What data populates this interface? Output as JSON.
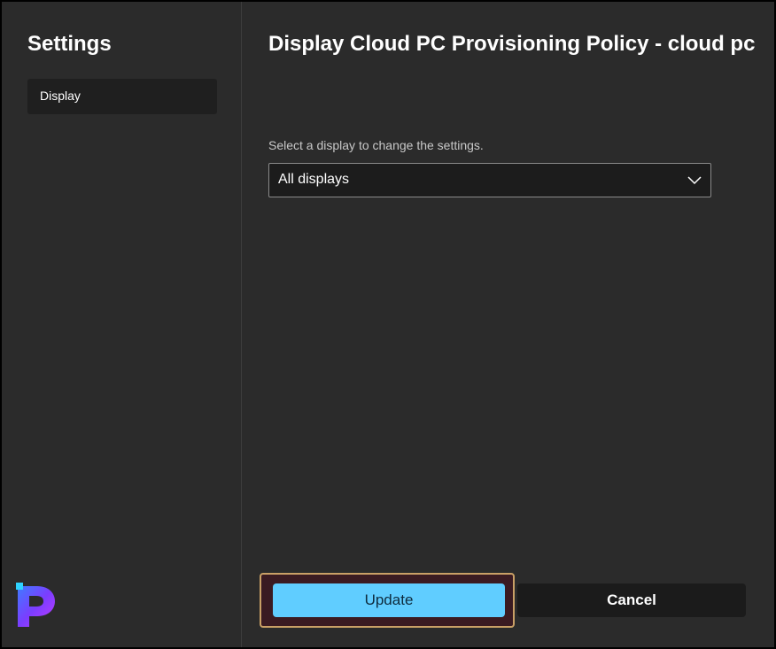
{
  "sidebar": {
    "title": "Settings",
    "items": [
      {
        "label": "Display",
        "selected": true
      }
    ],
    "logo_icon": "brand-p-logo"
  },
  "main": {
    "title": "Display Cloud PC Provisioning Policy - cloud pc",
    "display_select": {
      "label": "Select a display to change the settings.",
      "value": "All displays",
      "icon": "chevron-down-icon"
    }
  },
  "footer": {
    "update_label": "Update",
    "cancel_label": "Cancel"
  },
  "colors": {
    "background": "#2b2b2b",
    "accent": "#60cdff",
    "highlight": "#c9a066"
  }
}
